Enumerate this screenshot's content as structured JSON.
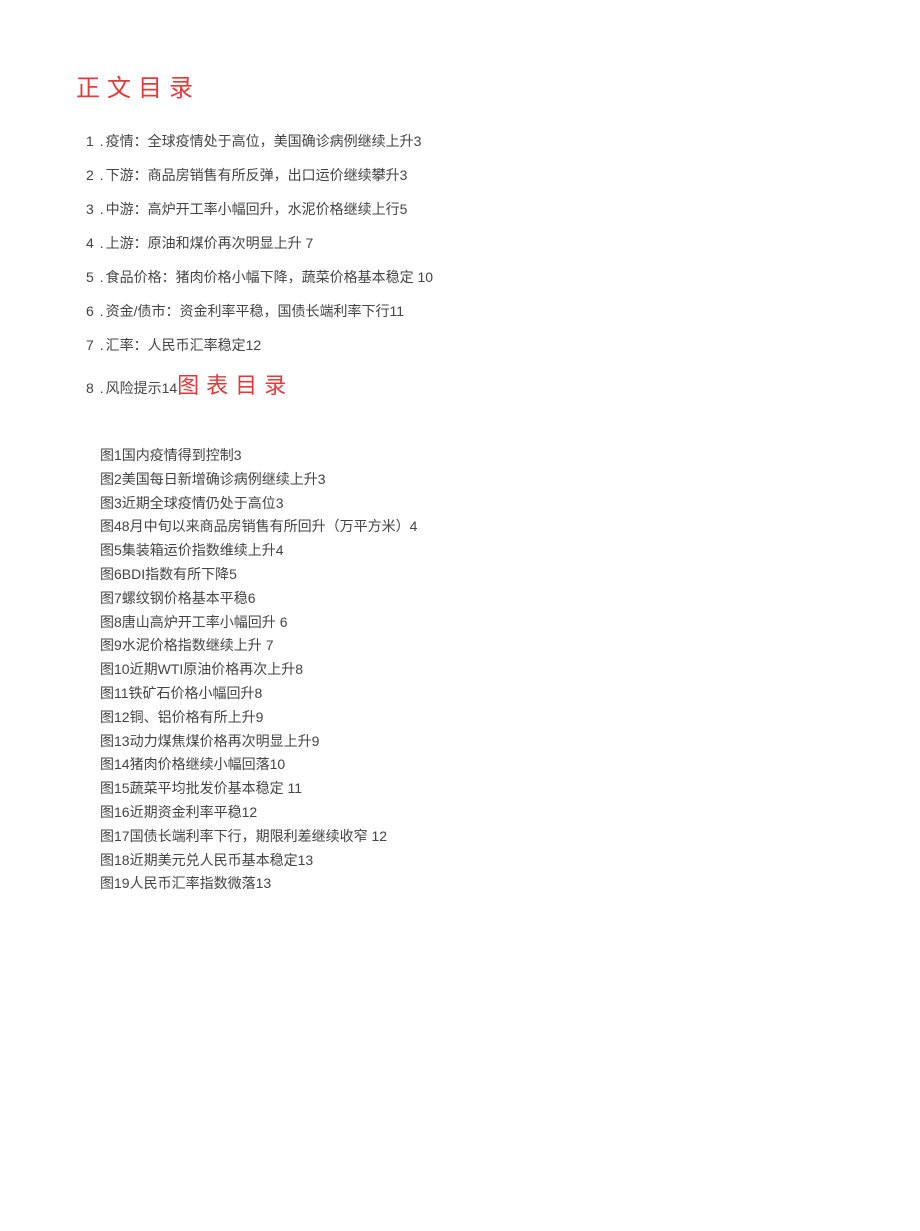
{
  "headings": {
    "main_toc": "正文目录",
    "figure_toc": "图表目录"
  },
  "toc": [
    {
      "num": "1",
      "title": "疫情：全球疫情处于高位，美国确诊病例继续上升",
      "page": "3"
    },
    {
      "num": "2",
      "title": "下游：商品房销售有所反弹，出口运价继续攀升",
      "page": "3"
    },
    {
      "num": "3",
      "title": "中游：高炉开工率小幅回升，水泥价格继续上行",
      "page": "5"
    },
    {
      "num": "4",
      "title": "上游：原油和煤价再次明显上升",
      "page": "7"
    },
    {
      "num": "5",
      "title": "食品价格：猪肉价格小幅下降，蔬菜价格基本稳定",
      "page": "10"
    },
    {
      "num": "6",
      "title": "资金/债市：资金利率平稳，国债长端利率下行",
      "page": "11"
    },
    {
      "num": "7",
      "title": "汇率：人民币汇率稳定",
      "page": "12"
    },
    {
      "num": "8",
      "title": "风险提示",
      "page": "14"
    }
  ],
  "figures": [
    {
      "label": "图1",
      "title": "国内疫情得到控制",
      "page": "3"
    },
    {
      "label": "图2",
      "title": "美国每日新增确诊病例继续上升",
      "page": "3"
    },
    {
      "label": "图3",
      "title": "近期全球疫情仍处于高位",
      "page": "3"
    },
    {
      "label": "图4",
      "title": "8月中旬以来商品房销售有所回升（万平方米）",
      "page": "4"
    },
    {
      "label": "图5",
      "title": "集装箱运价指数维续上升",
      "page": "4"
    },
    {
      "label": "图6",
      "title": "BDI指数有所下降",
      "page": "5"
    },
    {
      "label": "图7",
      "title": "螺纹钢价格基本平稳",
      "page": "6"
    },
    {
      "label": "图8",
      "title": "唐山高炉开工率小幅回升",
      "page": "6"
    },
    {
      "label": "图9",
      "title": "水泥价格指数继续上升",
      "page": "7"
    },
    {
      "label": "图10",
      "title": "近期WTI原油价格再次上升",
      "page": "8"
    },
    {
      "label": "图11",
      "title": "铁矿石价格小幅回升",
      "page": "8"
    },
    {
      "label": "图12",
      "title": "铜、铝价格有所上升",
      "page": "9"
    },
    {
      "label": "图13",
      "title": "动力煤焦煤价格再次明显上升",
      "page": "9"
    },
    {
      "label": "图14",
      "title": "猪肉价格继续小幅回落",
      "page": "10"
    },
    {
      "label": "图15",
      "title": "蔬菜平均批发价基本稳定",
      "page": "11"
    },
    {
      "label": "图16",
      "title": "近期资金利率平稳",
      "page": "12"
    },
    {
      "label": "图17",
      "title": "国债长端利率下行，期限利差继续收窄",
      "page": "12"
    },
    {
      "label": "图18",
      "title": "近期美元兑人民币基本稳定",
      "page": "13"
    },
    {
      "label": "图19",
      "title": "人民币汇率指数微落",
      "page": "13"
    }
  ]
}
